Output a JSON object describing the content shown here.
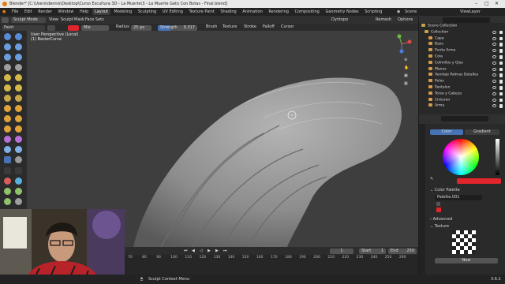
{
  "titlebar": {
    "title": "Blender* [C:\\Users\\dennis\\Desktop\\Curso Escultura 3D - La Muerte\\3 - La Muerte Gato Con Botas - Final.blend]"
  },
  "menubar": {
    "menus": [
      "File",
      "Edit",
      "Render",
      "Window",
      "Help"
    ],
    "workspaces": [
      "Layout",
      "Modeling",
      "Sculpting",
      "UV Editing",
      "Texture Paint",
      "Shading",
      "Animation",
      "Rendering",
      "Compositing",
      "Geometry Nodes",
      "Scripting"
    ],
    "active_workspace": "Layout",
    "scene": "Scene",
    "view_layer": "ViewLayer"
  },
  "header": {
    "mode": "Sculpt Mode",
    "view": "View",
    "sculpt": "Sculpt",
    "mask": "Mask",
    "face_sets": "Face Sets",
    "dyntopo": "Dyntopo",
    "remesh": "Remesh",
    "options": "Options"
  },
  "toolheader": {
    "brush_name": "Paint",
    "blend": "Mix",
    "radius_label": "Radius",
    "radius_value": "25 px",
    "strength_label": "Strength",
    "strength_value": "0.317",
    "strength_fill": 0.317,
    "brush": "Brush",
    "texture": "Texture",
    "stroke": "Stroke",
    "falloff": "Falloff",
    "cursor": "Cursor",
    "color": "#e0252d"
  },
  "viewport": {
    "view_name": "User Perspective (Local)",
    "object_name": "(1) BezierCurve"
  },
  "timeline": {
    "frame_current": "1",
    "start_label": "Start",
    "start": "1",
    "end_label": "End",
    "end": "250",
    "ticks": [
      "70",
      "80",
      "90",
      "100",
      "110",
      "120",
      "130",
      "140",
      "150",
      "160",
      "170",
      "180",
      "190",
      "200",
      "210",
      "220",
      "230",
      "240",
      "250",
      "260"
    ]
  },
  "statusbar": {
    "hint": "Sculpt Context Menu",
    "version": "3.6.2"
  },
  "outliner": {
    "items": [
      {
        "label": "Scene Collection"
      },
      {
        "label": "Collection"
      },
      {
        "label": "Capa"
      },
      {
        "label": "Base"
      },
      {
        "label": "Punta Arma"
      },
      {
        "label": "Cola"
      },
      {
        "label": "Colmillos y Ojos"
      },
      {
        "label": "Manos"
      },
      {
        "label": "Vendaje Palmas Detalles"
      },
      {
        "label": "Pelos"
      },
      {
        "label": "Pantalon"
      },
      {
        "label": "Torso y Cabeza"
      },
      {
        "label": "Cinturon"
      },
      {
        "label": "Arma"
      }
    ]
  },
  "properties": {
    "tab_color": "Color",
    "tab_gradient": "Gradient",
    "color_palette": "Color Palette",
    "palette_name": "Palette.001",
    "advanced": "Advanced",
    "texture": "Texture",
    "new_button": "New",
    "swatch_color": "#e0252d"
  }
}
